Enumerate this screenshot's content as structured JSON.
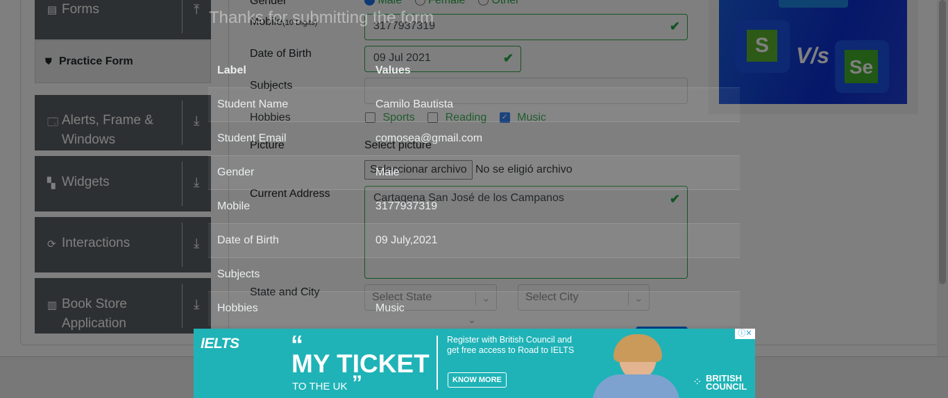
{
  "sidebar": {
    "forms": "Forms",
    "practice_form": "Practice Form",
    "alerts_line1": "Alerts, Frame &",
    "alerts_line2": "Windows",
    "widgets": "Widgets",
    "interactions": "Interactions",
    "bookstore_line1": "Book Store",
    "bookstore_line2": "Application"
  },
  "form": {
    "gender_label": "Gender",
    "gender_options": [
      "Male",
      "Female",
      "Other"
    ],
    "mobile_label": "Mobile",
    "mobile_hint": "(10 Digits)",
    "mobile_value": "3177937319",
    "dob_label": "Date of Birth",
    "dob_value": "09 Jul 2021",
    "subjects_label": "Subjects",
    "hobbies_label": "Hobbies",
    "hobby_sports": "Sports",
    "hobby_reading": "Reading",
    "hobby_music": "Music",
    "picture_label": "Picture",
    "select_picture": "Select picture",
    "file_button": "Seleccionar archivo",
    "file_status": "No se eligió archivo",
    "address_label": "Current Address",
    "address_value": "Cartagena San José de los Campanos",
    "state_city_label": "State and City",
    "state_placeholder": "Select State",
    "city_placeholder": "Select City"
  },
  "modal": {
    "title": "Thanks for submitting the form",
    "header_label": "Label",
    "header_values": "Values",
    "rows": [
      {
        "label": "Student Name",
        "value": "Camilo Bautista"
      },
      {
        "label": "Student Email",
        "value": "comosea@gmail.com"
      },
      {
        "label": "Gender",
        "value": "Male"
      },
      {
        "label": "Mobile",
        "value": "3177937319"
      },
      {
        "label": "Date of Birth",
        "value": "09 July,2021"
      },
      {
        "label": "Subjects",
        "value": ""
      },
      {
        "label": "Hobbies",
        "value": "Music"
      }
    ]
  },
  "ad_top": {
    "letter_s": "S",
    "vs": "V/s",
    "letter_se": "Se"
  },
  "ad_bottom": {
    "brand": "IELTS",
    "headline": "MY TICKET",
    "sub": "TO THE UK",
    "register": "Register with British Council and get free access to Road to IELTS",
    "cta": "KNOW MORE",
    "council_line1": "BRITISH",
    "council_line2": "COUNCIL"
  },
  "colors": {
    "sidebar_bg": "#5a6065",
    "valid_green": "#28a745",
    "ad_teal": "#1fb3b7",
    "ad_blue": "#0c2fd2"
  }
}
